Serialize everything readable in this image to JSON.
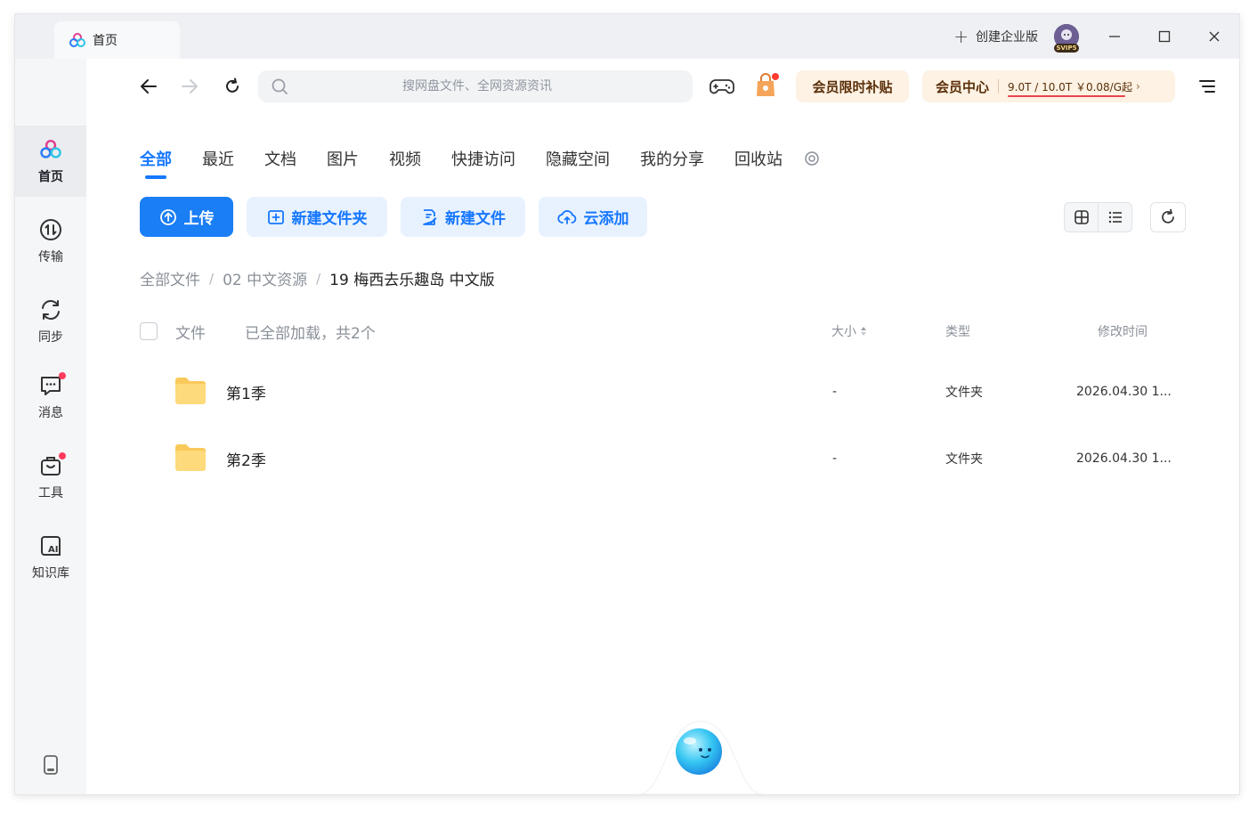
{
  "window": {
    "tab_title": "首页",
    "create_enterprise": "创建企业版",
    "user_badge": "SVIP5"
  },
  "sidebar": {
    "items": [
      {
        "label": "首页",
        "active": true
      },
      {
        "label": "传输"
      },
      {
        "label": "同步"
      },
      {
        "label": "消息",
        "dot": true
      },
      {
        "label": "工具",
        "dot": true
      },
      {
        "label": "知识库"
      }
    ]
  },
  "toolbar": {
    "search_placeholder": "搜网盘文件、全网资源资讯",
    "promo_label": "会员限时补贴",
    "vip_label": "会员中心",
    "vip_info": "9.0T / 10.0T   ￥0.08/G起"
  },
  "categories": {
    "items": [
      "全部",
      "最近",
      "文档",
      "图片",
      "视频",
      "快捷访问",
      "隐藏空间",
      "我的分享",
      "回收站"
    ],
    "active": "全部"
  },
  "actions": {
    "upload": "上传",
    "new_folder": "新建文件夹",
    "new_file": "新建文件",
    "cloud_add": "云添加"
  },
  "breadcrumb": {
    "items": [
      "全部文件",
      "02 中文资源",
      "19 梅西去乐趣岛 中文版"
    ],
    "separator": "/"
  },
  "file_list": {
    "columns": {
      "file": "文件",
      "loaded_status": "已全部加载，共2个",
      "size": "大小",
      "type": "类型",
      "mtime": "修改时间"
    },
    "rows": [
      {
        "name": "第1季",
        "size": "-",
        "type": "文件夹",
        "mtime": "2026.04.30 1..."
      },
      {
        "name": "第2季",
        "size": "-",
        "type": "文件夹",
        "mtime": "2026.04.30 1..."
      }
    ]
  },
  "colors": {
    "accent": "#1677ff",
    "primary_button": "#1a7ef5",
    "vip_bg": "#fdf2e3",
    "notification_dot": "#ff3b5c"
  }
}
